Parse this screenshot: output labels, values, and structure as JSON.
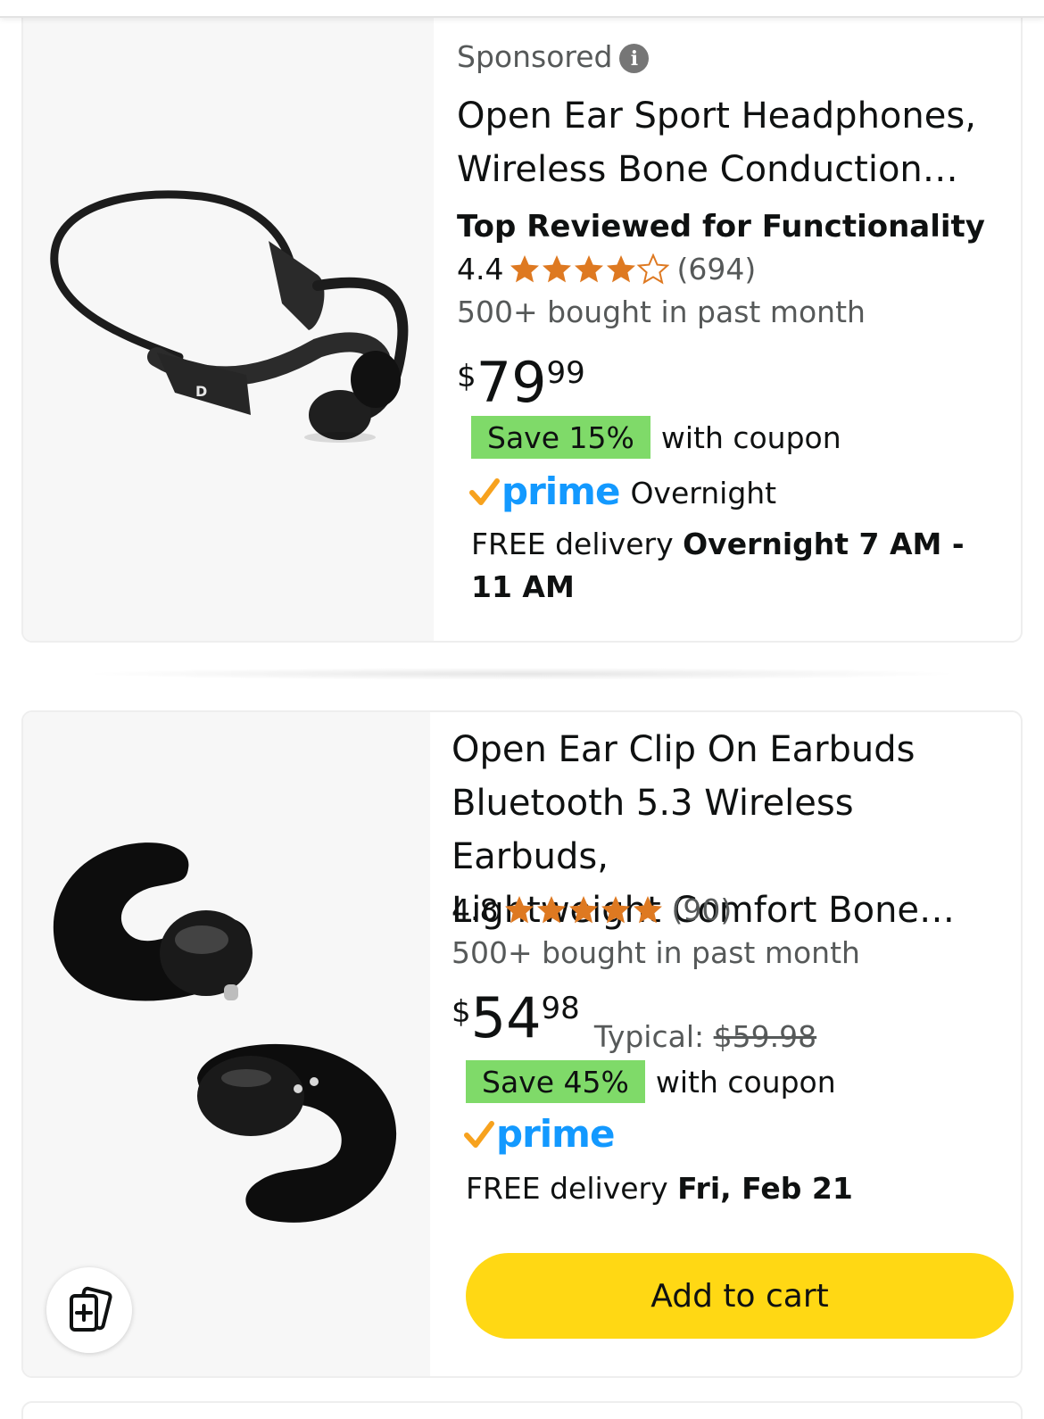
{
  "products": [
    {
      "sponsored_label": "Sponsored",
      "title_line1": "Open Ear Sport Headphones,",
      "title_line2": "Wireless Bone Conduction…",
      "badge": "Top Reviewed for Functionality",
      "rating": "4.4",
      "rating_value": 4.4,
      "review_count": "(694)",
      "bought": "500+ bought in past month",
      "price_symbol": "$",
      "price_whole": "79",
      "price_fraction": "99",
      "save_label": "Save 15%",
      "coupon_text": "with coupon",
      "prime_label": "prime",
      "prime_suffix": "Overnight",
      "delivery_prefix": "FREE delivery",
      "delivery_date": "Overnight 7 AM - 11 AM",
      "image_icon": "bone-conduction-headphones-image"
    },
    {
      "title_line1": "Open Ear Clip On Earbuds",
      "title_line2": "Bluetooth 5.3 Wireless Earbuds,",
      "title_line3": "Lightweight Comfort Bone…",
      "rating": "4.8",
      "rating_value": 4.8,
      "review_count": "(90)",
      "bought": "500+ bought in past month",
      "price_symbol": "$",
      "price_whole": "54",
      "price_fraction": "98",
      "typical_label": "Typical:",
      "typical_price": "$59.98",
      "save_label": "Save 45%",
      "coupon_text": "with coupon",
      "prime_label": "prime",
      "delivery_prefix": "FREE delivery",
      "delivery_date": "Fri, Feb 21",
      "add_to_cart": "Add to cart",
      "image_icon": "clip-on-earbuds-image",
      "compare_icon": "compare-icon"
    }
  ],
  "colors": {
    "star": "#de7921",
    "prime_blue": "#1399ff",
    "prime_check": "#f7a21e",
    "save_badge": "#7fda69",
    "add_to_cart": "#ffd814",
    "image_bg": "#f7f7f7"
  }
}
